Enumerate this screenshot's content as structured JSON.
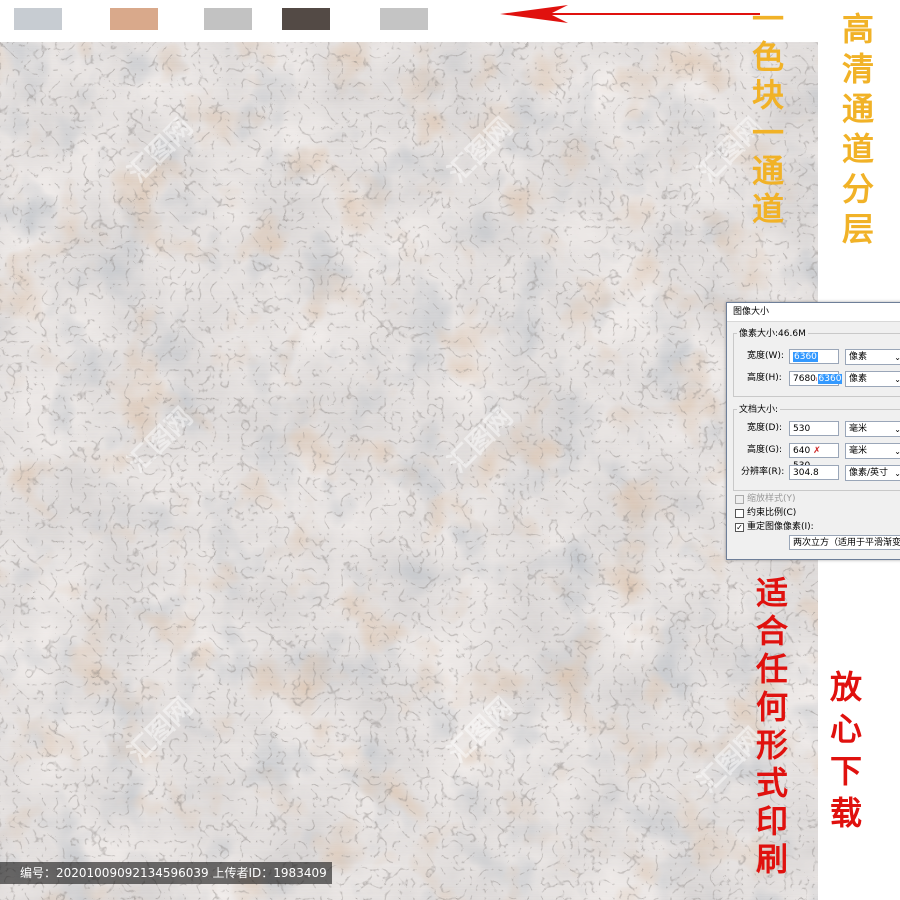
{
  "swatches": [
    {
      "name": "swatch-blue-grey",
      "color": "#c7ccd2"
    },
    {
      "name": "swatch-tan",
      "color": "#d9a98b"
    },
    {
      "name": "swatch-light-grey",
      "color": "#c2c2c2"
    },
    {
      "name": "swatch-dark-brown",
      "color": "#534a45"
    },
    {
      "name": "swatch-silver",
      "color": "#c4c4c4"
    }
  ],
  "annotations": {
    "channel_text": "一色块一通道",
    "hd_text": "高清通道分层",
    "print_text": "适合任何形式印刷",
    "download_text": "放心下载",
    "arrow_color": "#e0110e",
    "gold_color": "#f1b227",
    "red_color": "#e0110e"
  },
  "dialog": {
    "title": "图像大小",
    "pixel_size_label": "像素大小:46.6M",
    "width_label": "宽度(W):",
    "width_value": "6360",
    "width_unit": "像素",
    "height_label": "高度(H):",
    "height_old": "7680",
    "height_value": "6360",
    "height_unit": "像素",
    "doc_size_label": "文档大小:",
    "doc_width_label": "宽度(D):",
    "doc_width_value": "530",
    "doc_width_unit": "毫米",
    "doc_height_label": "高度(G):",
    "doc_height_old": "640",
    "doc_height_new": "530",
    "doc_height_unit": "毫米",
    "resolution_label": "分辨率(R):",
    "resolution_value": "304.8",
    "resolution_unit": "像素/英寸",
    "scale_styles_label": "缩放样式(Y)",
    "constrain_label": "约束比例(C)",
    "resample_label": "重定图像像素(I):",
    "resample_method": "两次立方（适用于平滑渐变"
  },
  "footer": {
    "text": "编号：20201009092134596039 上传者ID：1983409"
  },
  "watermark": {
    "text": "汇图网"
  }
}
